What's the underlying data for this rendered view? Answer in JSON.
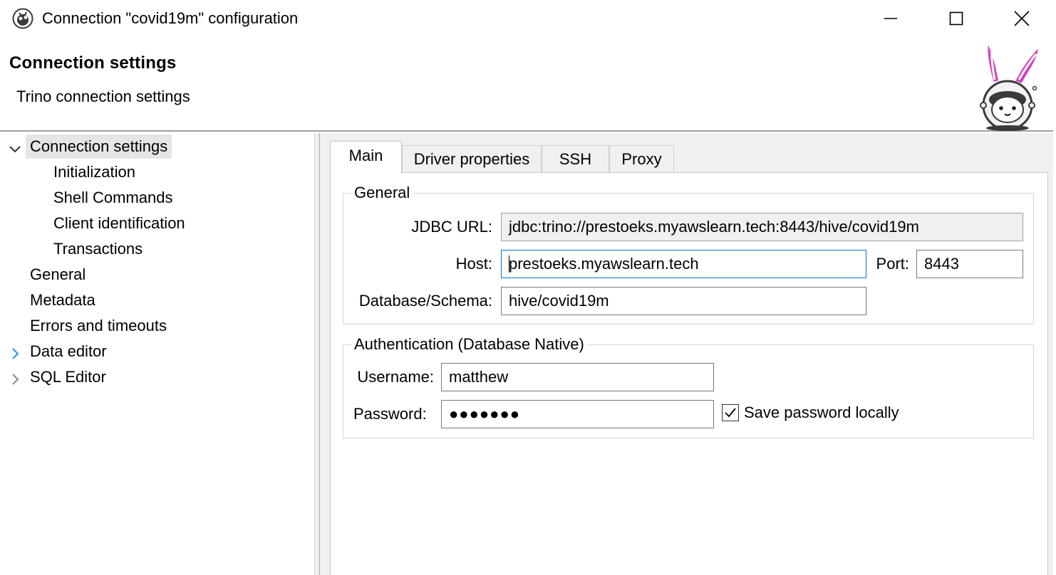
{
  "window": {
    "title": "Connection \"covid19m\" configuration",
    "app_icon": "dbeaver-icon",
    "controls": [
      "minimize-icon",
      "maximize-icon",
      "close-icon"
    ]
  },
  "header": {
    "title": "Connection settings",
    "subtitle": "Trino connection settings",
    "logo": "dbeaver-mascot-logo"
  },
  "nav": {
    "items": [
      {
        "label": "Connection settings",
        "expanded": true,
        "selected": true
      },
      {
        "label": "Initialization"
      },
      {
        "label": "Shell Commands"
      },
      {
        "label": "Client identification"
      },
      {
        "label": "Transactions"
      },
      {
        "label": "General"
      },
      {
        "label": "Metadata"
      },
      {
        "label": "Errors and timeouts"
      },
      {
        "label": "Data editor",
        "expandable": true
      },
      {
        "label": "SQL Editor",
        "expandable": true
      }
    ]
  },
  "tabs": [
    {
      "label": "Main",
      "active": true
    },
    {
      "label": "Driver properties"
    },
    {
      "label": "SSH"
    },
    {
      "label": "Proxy"
    }
  ],
  "general": {
    "title": "General",
    "jdbc_label": "JDBC URL:",
    "jdbc_value": "jdbc:trino://prestoeks.myawslearn.tech:8443/hive/covid19m",
    "host_label": "Host:",
    "host_value": "prestoeks.myawslearn.tech",
    "port_label": "Port:",
    "port_value": "8443",
    "db_label": "Database/Schema:",
    "db_value": "hive/covid19m"
  },
  "auth": {
    "title": "Authentication (Database Native)",
    "username_label": "Username:",
    "username_value": "matthew",
    "password_label": "Password:",
    "password_value": "●●●●●●●",
    "save_password_label": "Save password locally",
    "save_password_checked": true
  },
  "colors": {
    "focus_border": "#0078d7",
    "selection_bg": "#e5e5e5",
    "panel_bg": "#f0f0f0",
    "expand_arrow_blue": "#2f9ede",
    "mascot_pink": "#d43fbc"
  }
}
